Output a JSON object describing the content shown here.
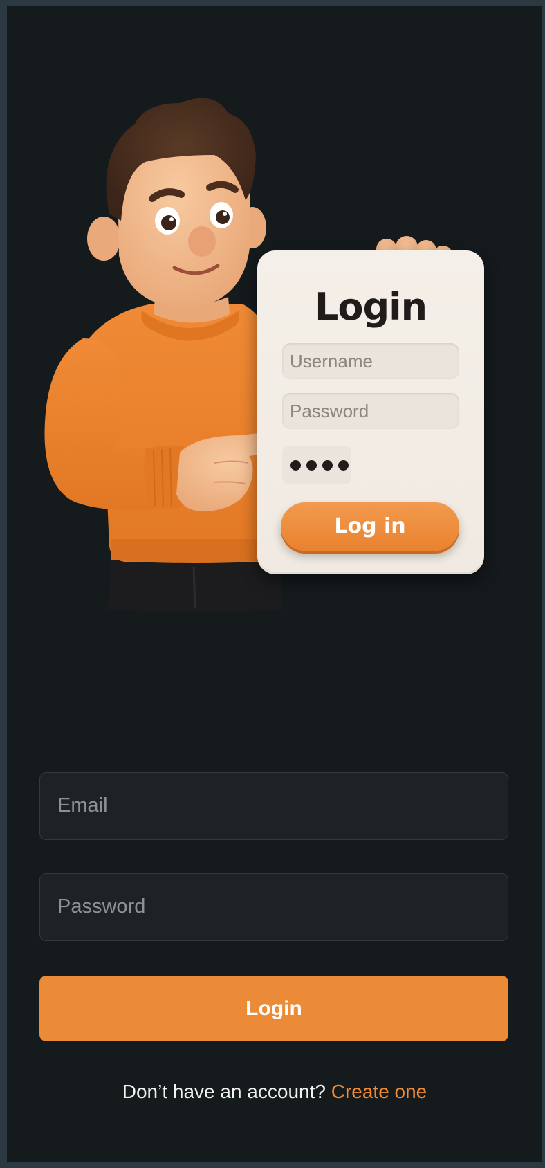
{
  "colors": {
    "background": "#151a1d",
    "accent": "#eb8a37",
    "input_bg": "#1e2225"
  },
  "illustration": {
    "card": {
      "title": "Login",
      "username_placeholder": "Username",
      "password_placeholder": "Password",
      "button_label": "Log in"
    }
  },
  "form": {
    "email_placeholder": "Email",
    "password_placeholder": "Password",
    "login_label": "Login",
    "signup_prompt": "Don’t have an account?",
    "signup_link": "Create one"
  }
}
